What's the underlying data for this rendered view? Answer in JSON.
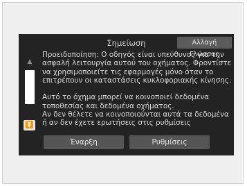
{
  "dialog": {
    "title": "Σημείωση",
    "language_button": "Αλλαγή Γλώσσας"
  },
  "message": {
    "paragraph1": [
      "Προειδοποίηση: Ο οδηγός είναι υπεύθυνος για την",
      "ασφαλή λειτουργία αυτού του οχήματος. Φροντίστε",
      "να χρησιμοποιείτε τις εφαρμογές μόνο όταν το",
      "επιτρέπουν οι καταστάσεις κυκλοφοριακής κίνησης."
    ],
    "paragraph2": [
      "Αυτό το όχημα μπορεί να κοινοποιεί δεδομένα",
      "τοποθεσίας και δεδομένα οχήματος.",
      "Αν δεν θέλετε να κοινοποιούνται αυτά τα δεδομένα",
      "ή αν δεν έχετε ερωτήσεις στις ρυθμίσεις"
    ]
  },
  "scroll": {
    "up_icon": "scroll-up-arrow-icon",
    "down_icon": "scroll-down-arrow-icon"
  },
  "buttons": {
    "start": "Έναρξη",
    "settings": "Ρυθμίσεις"
  }
}
